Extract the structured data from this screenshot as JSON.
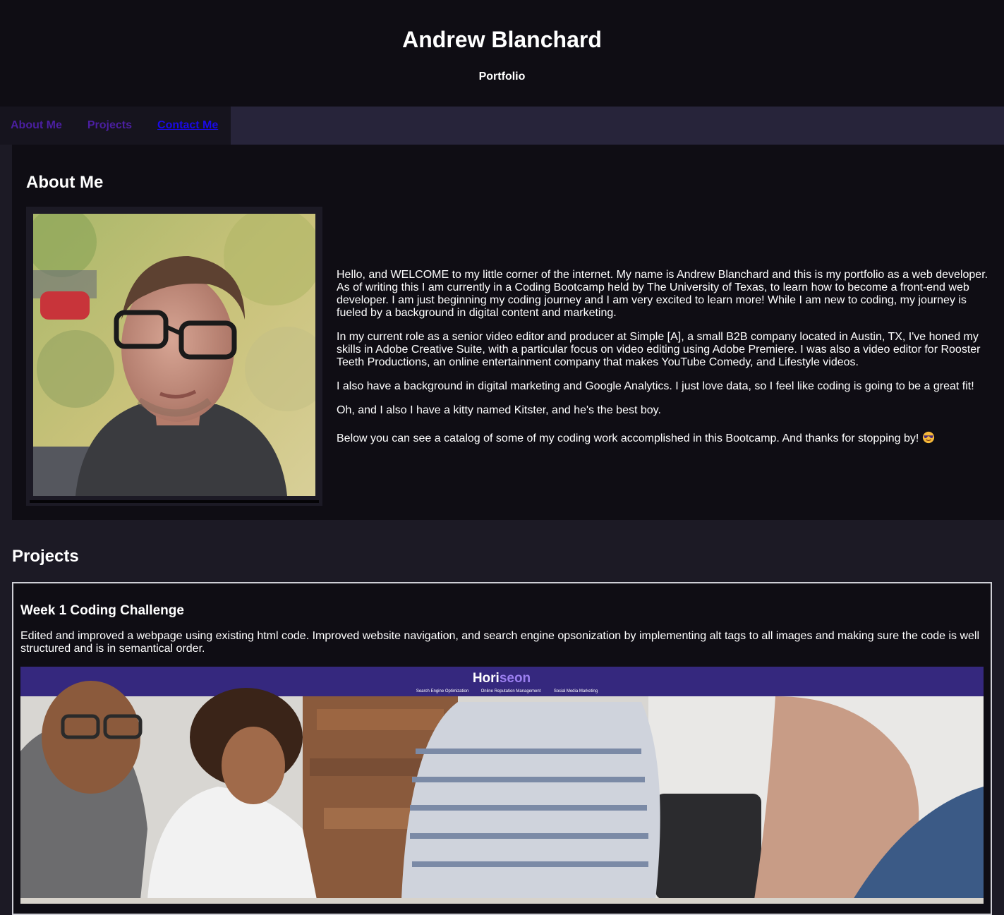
{
  "header": {
    "title": "Andrew Blanchard",
    "subtitle": "Portfolio"
  },
  "nav": {
    "items": [
      {
        "label": "About Me"
      },
      {
        "label": "Projects"
      },
      {
        "label": "Contact Me"
      }
    ]
  },
  "about": {
    "heading": "About Me",
    "photo_alt": "Portrait photo of Andrew Blanchard",
    "paragraphs": [
      "Hello, and WELCOME to my little corner of the internet. My name is Andrew Blanchard and this is my portfolio as a web developer. As of writing this I am currently in a Coding Bootcamp held by The University of Texas, to learn how to become a front-end web developer. I am just beginning my coding journey and I am very excited to learn more! While I am new to coding, my journey is fueled by a background in digital content and marketing.",
      "In my current role as a senior video editor and producer at Simple [A], a small B2B company located in Austin, TX, I've honed my skills in Adobe Creative Suite, with a particular focus on video editing using Adobe Premiere. I was also a video editor for Rooster Teeth Productions, an online entertainment company that makes YouTube Comedy, and Lifestyle videos.",
      "I also have a background in digital marketing and Google Analytics. I just love data, so I feel like coding is going to be a great fit!",
      "Oh, and I also I have a kitty named Kitster, and he's the best boy.",
      "Below you can see a catalog of some of my coding work accomplished in this Bootcamp. And thanks for stopping by!"
    ],
    "emoji_icon": "smiling-face-with-sunglasses-icon"
  },
  "projects": {
    "heading": "Projects",
    "items": [
      {
        "title": "Week 1 Coding Challenge",
        "description": "Edited and improved a webpage using existing html code. Improved website navigation, and search engine opsonization by implementing alt tags to all images and making sure the code is well structured and is in semantical order.",
        "screenshot": {
          "brand_prefix": "Hori",
          "brand_suffix": "seon",
          "nav_items": [
            "Search Engine Optimization",
            "Online Reputation Management",
            "Social Media Marketing"
          ]
        }
      }
    ]
  },
  "colors": {
    "page_bg": "#1c1a25",
    "header_bg": "#0f0d14",
    "nav_bg": "#27243a",
    "nav_link": "#4b1fa1",
    "nav_link_active": "#1a0ae6",
    "horiseon_purple": "#35287e",
    "horiseon_accent": "#9b7ff0"
  }
}
